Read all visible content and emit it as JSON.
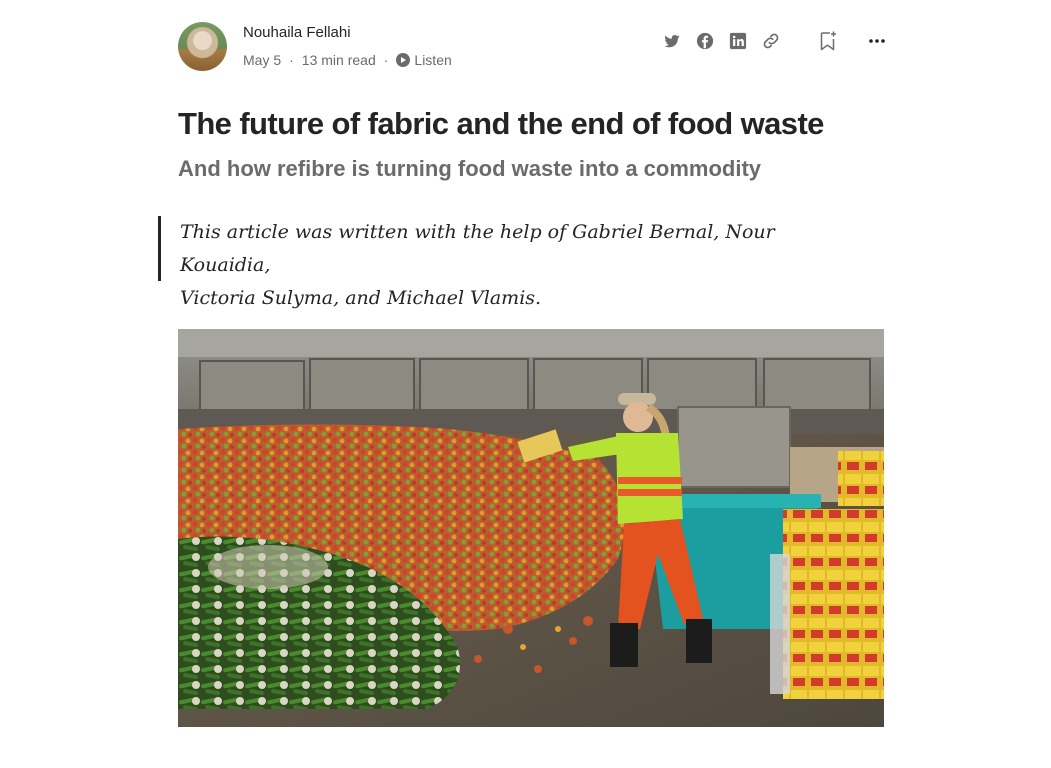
{
  "author": {
    "name": "Nouhaila Fellahi",
    "date": "May 5",
    "read_time": "13 min read",
    "listen_label": "Listen"
  },
  "actions": {
    "icons": [
      "twitter-icon",
      "facebook-icon",
      "linkedin-icon",
      "link-icon",
      "bookmark-icon",
      "more-icon"
    ]
  },
  "article": {
    "title": "The future of fabric and the end of food waste",
    "subtitle": "And how refibre is turning food waste into a commodity",
    "quote_line1": "This article was written with the help of Gabriel Bernal, Nour Kouaidia,",
    "quote_line2": "Victoria Sulyma, and Michael Vlamis."
  },
  "colors": {
    "text": "#242424",
    "muted": "#6b6b6b",
    "safety_vest": "#b6e234",
    "bin": "#1c9ea0"
  }
}
